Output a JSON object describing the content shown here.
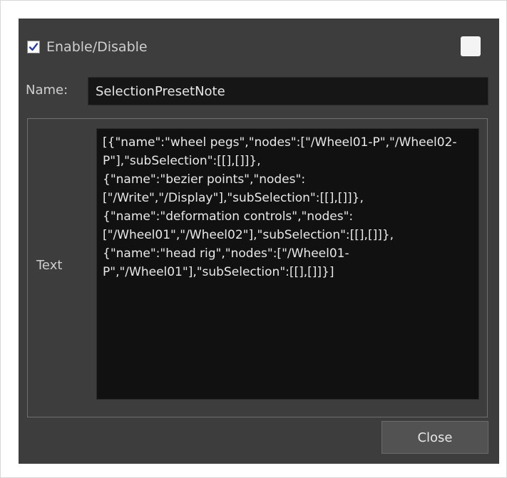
{
  "enable": {
    "label": "Enable/Disable",
    "checked": true
  },
  "color_swatch": {
    "color": "#f4f4f4"
  },
  "name": {
    "label": "Name:",
    "value": "SelectionPresetNote"
  },
  "text": {
    "label": "Text",
    "value": "[{\"name\":\"wheel pegs\",\"nodes\":[\"/Wheel01-P\",\"/Wheel02-P\"],\"subSelection\":[[],[]]},\n{\"name\":\"bezier points\",\"nodes\":\n[\"/Write\",\"/Display\"],\"subSelection\":[[],[]]},\n{\"name\":\"deformation controls\",\"nodes\":\n[\"/Wheel01\",\"/Wheel02\"],\"subSelection\":[[],[]]},\n{\"name\":\"head rig\",\"nodes\":[\"/Wheel01-P\",\"/Wheel01\"],\"subSelection\":[[],[]]}]"
  },
  "close_button": {
    "label": "Close"
  }
}
